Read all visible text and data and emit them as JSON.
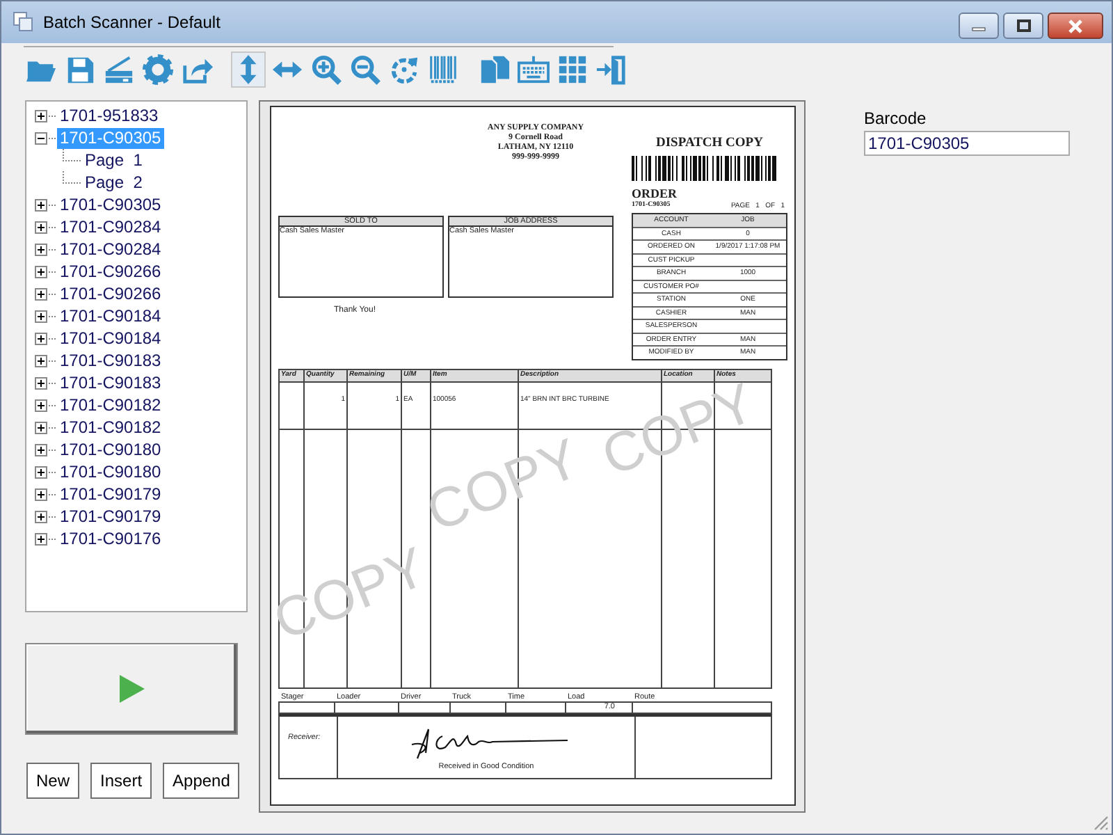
{
  "window": {
    "title": "Batch Scanner - Default"
  },
  "toolbar": {
    "groups": [
      {
        "buttons": [
          {
            "pressed": false
          },
          {
            "pressed": false
          },
          {
            "pressed": false
          },
          {
            "pressed": false
          },
          {
            "pressed": false
          }
        ]
      },
      {
        "buttons": [
          {
            "pressed": true
          },
          {
            "pressed": false
          },
          {
            "pressed": false
          },
          {
            "pressed": false
          },
          {
            "pressed": false
          },
          {
            "pressed": false
          }
        ]
      },
      {
        "buttons": [
          {
            "pressed": false
          },
          {
            "pressed": false
          },
          {
            "pressed": false
          },
          {
            "pressed": false
          }
        ]
      }
    ]
  },
  "tree": {
    "items": [
      {
        "label": "1701-951833",
        "expanded": false,
        "selected": false
      },
      {
        "label": "1701-C90305",
        "expanded": true,
        "selected": true,
        "children": [
          {
            "label": "Page  1",
            "selected": false
          },
          {
            "label": "Page  2",
            "selected": false
          }
        ]
      },
      {
        "label": "1701-C90305",
        "expanded": false,
        "selected": false
      },
      {
        "label": "1701-C90284",
        "expanded": false,
        "selected": false
      },
      {
        "label": "1701-C90284",
        "expanded": false,
        "selected": false
      },
      {
        "label": "1701-C90266",
        "expanded": false,
        "selected": false
      },
      {
        "label": "1701-C90266",
        "expanded": false,
        "selected": false
      },
      {
        "label": "1701-C90184",
        "expanded": false,
        "selected": false
      },
      {
        "label": "1701-C90184",
        "expanded": false,
        "selected": false
      },
      {
        "label": "1701-C90183",
        "expanded": false,
        "selected": false
      },
      {
        "label": "1701-C90183",
        "expanded": false,
        "selected": false
      },
      {
        "label": "1701-C90182",
        "expanded": false,
        "selected": false
      },
      {
        "label": "1701-C90182",
        "expanded": false,
        "selected": false
      },
      {
        "label": "1701-C90180",
        "expanded": false,
        "selected": false
      },
      {
        "label": "1701-C90180",
        "expanded": false,
        "selected": false
      },
      {
        "label": "1701-C90179",
        "expanded": false,
        "selected": false
      },
      {
        "label": "1701-C90179",
        "expanded": false,
        "selected": false
      },
      {
        "label": "1701-C90176",
        "expanded": false,
        "selected": false
      }
    ]
  },
  "buttons": [
    "New",
    "Insert",
    "Append"
  ],
  "barcode": {
    "label": "Barcode",
    "value": "1701-C90305"
  },
  "document": {
    "company": [
      "ANY SUPPLY COMPANY",
      "9 Cornell Road",
      "LATHAM, NY  12110",
      "999-999-9999"
    ],
    "copy_title": "DISPATCH COPY",
    "doc_type": "ORDER",
    "order_number": "1701-C90305",
    "page_label": "PAGE   1   OF   1",
    "sold_to": {
      "heading": "SOLD TO",
      "text": "Cash Sales Master"
    },
    "job_address": {
      "heading": "JOB ADDRESS",
      "text": "Cash Sales Master"
    },
    "thanks": "Thank You!",
    "info": [
      {
        "label": "ACCOUNT",
        "value": "JOB"
      },
      {
        "label": "CASH",
        "value": "0"
      },
      {
        "label": "ORDERED ON",
        "value": "1/9/2017 1:17:08 PM"
      },
      {
        "label": "CUST PICKUP"
      },
      {
        "label": "BRANCH",
        "value": "1000"
      },
      {
        "label": "CUSTOMER PO#"
      },
      {
        "label": "STATION",
        "value": "ONE"
      },
      {
        "label": "CASHIER",
        "value": "MAN"
      },
      {
        "label": "SALESPERSON"
      },
      {
        "label": "ORDER ENTRY",
        "value": "MAN"
      },
      {
        "label": "MODIFIED BY",
        "value": "MAN"
      }
    ],
    "items": {
      "columns": [
        "Yard",
        "Quantity",
        "Remaining",
        "U/M",
        "Item",
        "Description",
        "Location",
        "Notes"
      ],
      "rows": [
        [
          null,
          "1",
          "1",
          "EA",
          "100056",
          "14\" BRN INT BRC TURBINE",
          null,
          null
        ]
      ]
    },
    "delivery": {
      "columns": [
        {
          "label": "Stager"
        },
        {
          "label": "Loader"
        },
        {
          "label": "Driver"
        },
        {
          "label": "Truck"
        },
        {
          "label": "Time"
        },
        {
          "label": "Load",
          "value": "7.0"
        },
        {
          "label": "Route"
        }
      ]
    },
    "receiver_label": "Receiver:",
    "received_note": "Received in Good Condition",
    "stamps": [
      "COPY",
      "COPY",
      "COPY"
    ]
  }
}
